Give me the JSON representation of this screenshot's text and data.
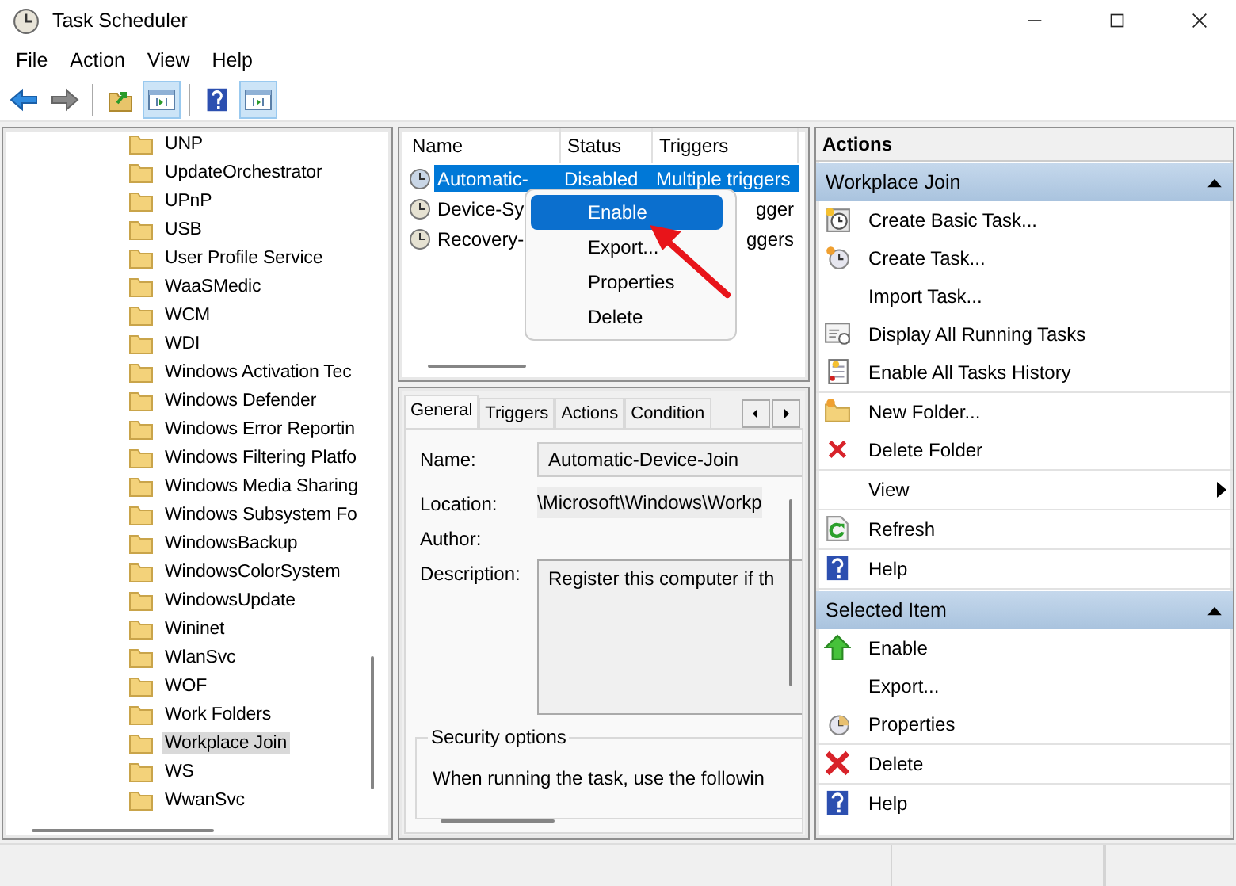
{
  "window": {
    "title": "Task Scheduler"
  },
  "menu": [
    "File",
    "Action",
    "View",
    "Help"
  ],
  "toolbar": [
    {
      "kind": "back",
      "pressed": false
    },
    {
      "kind": "forward",
      "pressed": false
    },
    {
      "kind": "sep"
    },
    {
      "kind": "up-folder",
      "pressed": false
    },
    {
      "kind": "tree-pane",
      "pressed": true
    },
    {
      "kind": "sep"
    },
    {
      "kind": "help",
      "pressed": false
    },
    {
      "kind": "action-pane",
      "pressed": true
    }
  ],
  "tree": {
    "items": [
      {
        "label": "UNP",
        "selected": false
      },
      {
        "label": "UpdateOrchestrator",
        "selected": false
      },
      {
        "label": "UPnP",
        "selected": false
      },
      {
        "label": "USB",
        "selected": false
      },
      {
        "label": "User Profile Service",
        "selected": false
      },
      {
        "label": "WaaSMedic",
        "selected": false
      },
      {
        "label": "WCM",
        "selected": false
      },
      {
        "label": "WDI",
        "selected": false
      },
      {
        "label": "Windows Activation Tec",
        "selected": false
      },
      {
        "label": "Windows Defender",
        "selected": false
      },
      {
        "label": "Windows Error Reportin",
        "selected": false
      },
      {
        "label": "Windows Filtering Platfo",
        "selected": false
      },
      {
        "label": "Windows Media Sharing",
        "selected": false
      },
      {
        "label": "Windows Subsystem Fo",
        "selected": false
      },
      {
        "label": "WindowsBackup",
        "selected": false
      },
      {
        "label": "WindowsColorSystem",
        "selected": false
      },
      {
        "label": "WindowsUpdate",
        "selected": false
      },
      {
        "label": "Wininet",
        "selected": false
      },
      {
        "label": "WlanSvc",
        "selected": false
      },
      {
        "label": "WOF",
        "selected": false
      },
      {
        "label": "Work Folders",
        "selected": false
      },
      {
        "label": "Workplace Join",
        "selected": true
      },
      {
        "label": "WS",
        "selected": false
      },
      {
        "label": "WwanSvc",
        "selected": false
      }
    ]
  },
  "task_list": {
    "columns": [
      "Name",
      "Status",
      "Triggers"
    ],
    "rows": [
      {
        "name": "Automatic-",
        "status": "Disabled",
        "triggers": "Multiple triggers",
        "selected": true
      },
      {
        "name": "Device-Sy",
        "triggers": "gger",
        "selected": false
      },
      {
        "name": "Recovery-",
        "triggers": "ggers",
        "selected": false
      }
    ]
  },
  "context_menu": {
    "items": [
      {
        "label": "Enable",
        "selected": true
      },
      {
        "label": "Export...",
        "selected": false
      },
      {
        "label": "Properties",
        "selected": false
      },
      {
        "label": "Delete",
        "selected": false
      }
    ]
  },
  "details": {
    "tabs": [
      {
        "label": "General",
        "selected": true
      },
      {
        "label": "Triggers",
        "selected": false
      },
      {
        "label": "Actions",
        "selected": false
      },
      {
        "label": "Condition",
        "selected": false
      }
    ],
    "fields": [
      {
        "label": "Name:",
        "value": "Automatic-Device-Join",
        "kind": "box"
      },
      {
        "label": "Location:",
        "value": "\\Microsoft\\Windows\\Workp",
        "kind": "plain"
      },
      {
        "label": "Author:",
        "kind": "plain"
      },
      {
        "label": "Description:",
        "value": "Register this computer if th",
        "kind": "area"
      }
    ],
    "security": {
      "title": "Security options",
      "text": "When running the task, use the followin"
    }
  },
  "actions_pane": {
    "title": "Actions",
    "sections": [
      {
        "title": "Workplace Join",
        "expanded": true,
        "groups": [
          [
            {
              "label": "Create Basic Task...",
              "kind": "basic-task"
            },
            {
              "label": "Create Task...",
              "kind": "create-task"
            },
            {
              "label": "Import Task...",
              "kind": "plain"
            },
            {
              "label": "Display All Running Tasks",
              "kind": "running"
            },
            {
              "label": "Enable All Tasks History",
              "kind": "history"
            }
          ],
          [
            {
              "label": "New Folder...",
              "kind": "new-folder"
            },
            {
              "label": "Delete Folder",
              "kind": "delete-small"
            }
          ],
          [
            {
              "label": "View",
              "kind": "plain",
              "submenu": true
            }
          ],
          [
            {
              "label": "Refresh",
              "kind": "refresh"
            }
          ],
          [
            {
              "label": "Help",
              "kind": "help"
            }
          ]
        ]
      },
      {
        "title": "Selected Item",
        "expanded": true,
        "groups": [
          [
            {
              "label": "Enable",
              "kind": "enable"
            },
            {
              "label": "Export...",
              "kind": "plain"
            },
            {
              "label": "Properties",
              "kind": "properties"
            }
          ],
          [
            {
              "label": "Delete",
              "kind": "delete"
            }
          ],
          [
            {
              "label": "Help",
              "kind": "help"
            }
          ]
        ]
      }
    ]
  }
}
